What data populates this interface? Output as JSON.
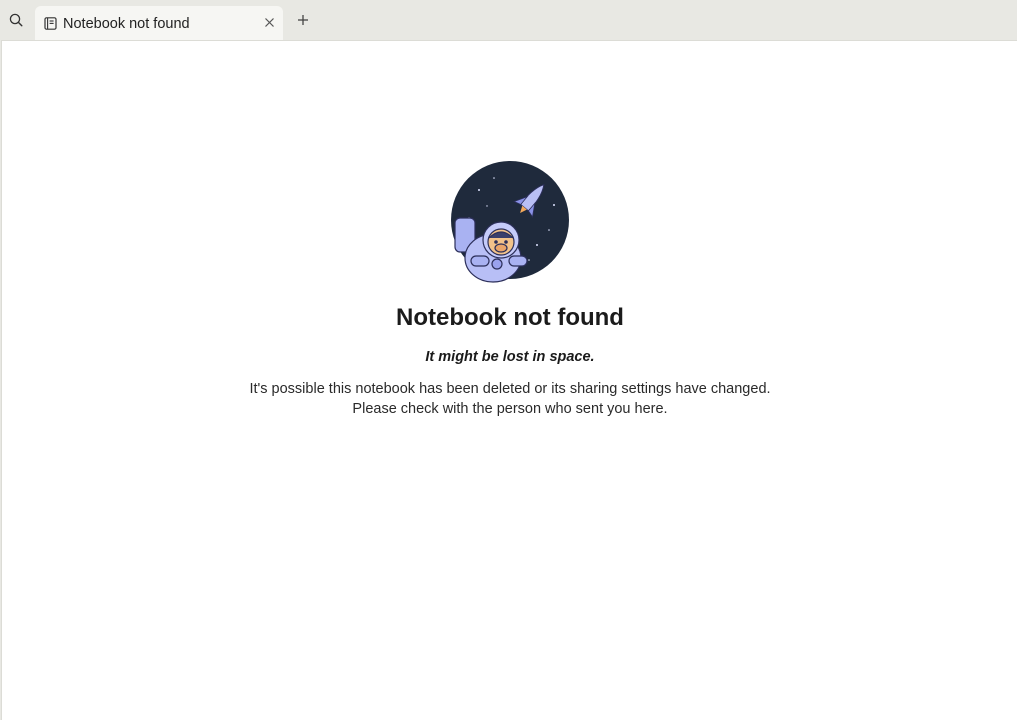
{
  "tabbar": {
    "search_icon": "search-icon",
    "tab": {
      "icon": "notebook-icon",
      "label": "Notebook not found",
      "close_icon": "close-icon"
    },
    "new_tab_icon": "plus-icon"
  },
  "main": {
    "illustration": "astronaut-in-space",
    "title": "Notebook not found",
    "subtitle": "It might be lost in space.",
    "description_line1": "It's possible this notebook has been deleted or its sharing settings have changed.",
    "description_line2": "Please check with the person who sent you here."
  },
  "colors": {
    "tabbar_bg": "#e8e8e3",
    "active_tab_bg": "#f6f6f3",
    "content_bg": "#ffffff",
    "space_bg": "#1f2a3c",
    "astronaut": "#a9b2f2"
  }
}
